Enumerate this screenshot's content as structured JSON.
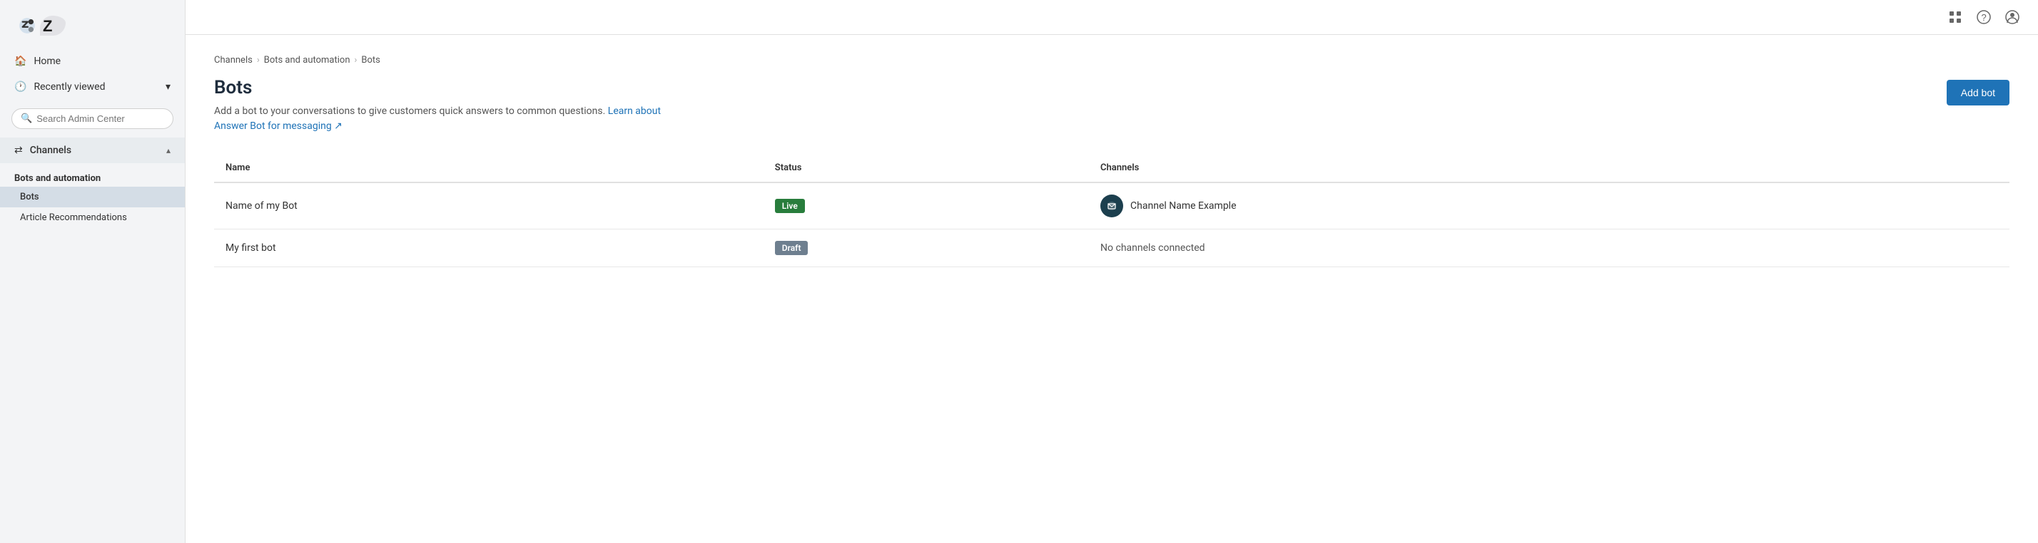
{
  "sidebar": {
    "logo_alt": "Zendesk",
    "nav_items": [
      {
        "id": "home",
        "label": "Home",
        "icon": "home-icon"
      }
    ],
    "recently_viewed": {
      "label": "Recently viewed",
      "chevron": "▾"
    },
    "search": {
      "placeholder": "Search Admin Center"
    },
    "channels_section": {
      "label": "Channels",
      "chevron": "▴",
      "groups": [
        {
          "label": "Bots and automation",
          "items": [
            {
              "id": "bots",
              "label": "Bots",
              "active": true
            },
            {
              "id": "article-recommendations",
              "label": "Article Recommendations",
              "active": false
            }
          ]
        }
      ]
    }
  },
  "topbar": {
    "grid_icon": "grid-icon",
    "help_icon": "help-icon",
    "profile_icon": "profile-icon"
  },
  "main": {
    "breadcrumb": {
      "items": [
        "Channels",
        "Bots and automation",
        "Bots"
      ],
      "separators": [
        "›",
        "›"
      ]
    },
    "page_title": "Bots",
    "page_description": "Add a bot to your conversations to give customers quick answers to common questions.",
    "learn_link_text": "Learn about Answer Bot for messaging ↗",
    "learn_link_href": "#",
    "add_bot_label": "Add bot",
    "table": {
      "columns": [
        "Name",
        "Status",
        "Channels"
      ],
      "rows": [
        {
          "name": "Name of my Bot",
          "status": "Live",
          "status_type": "live",
          "channel": "Channel Name Example",
          "has_channel_icon": true
        },
        {
          "name": "My first bot",
          "status": "Draft",
          "status_type": "draft",
          "channel": "No channels connected",
          "has_channel_icon": false
        }
      ]
    }
  }
}
